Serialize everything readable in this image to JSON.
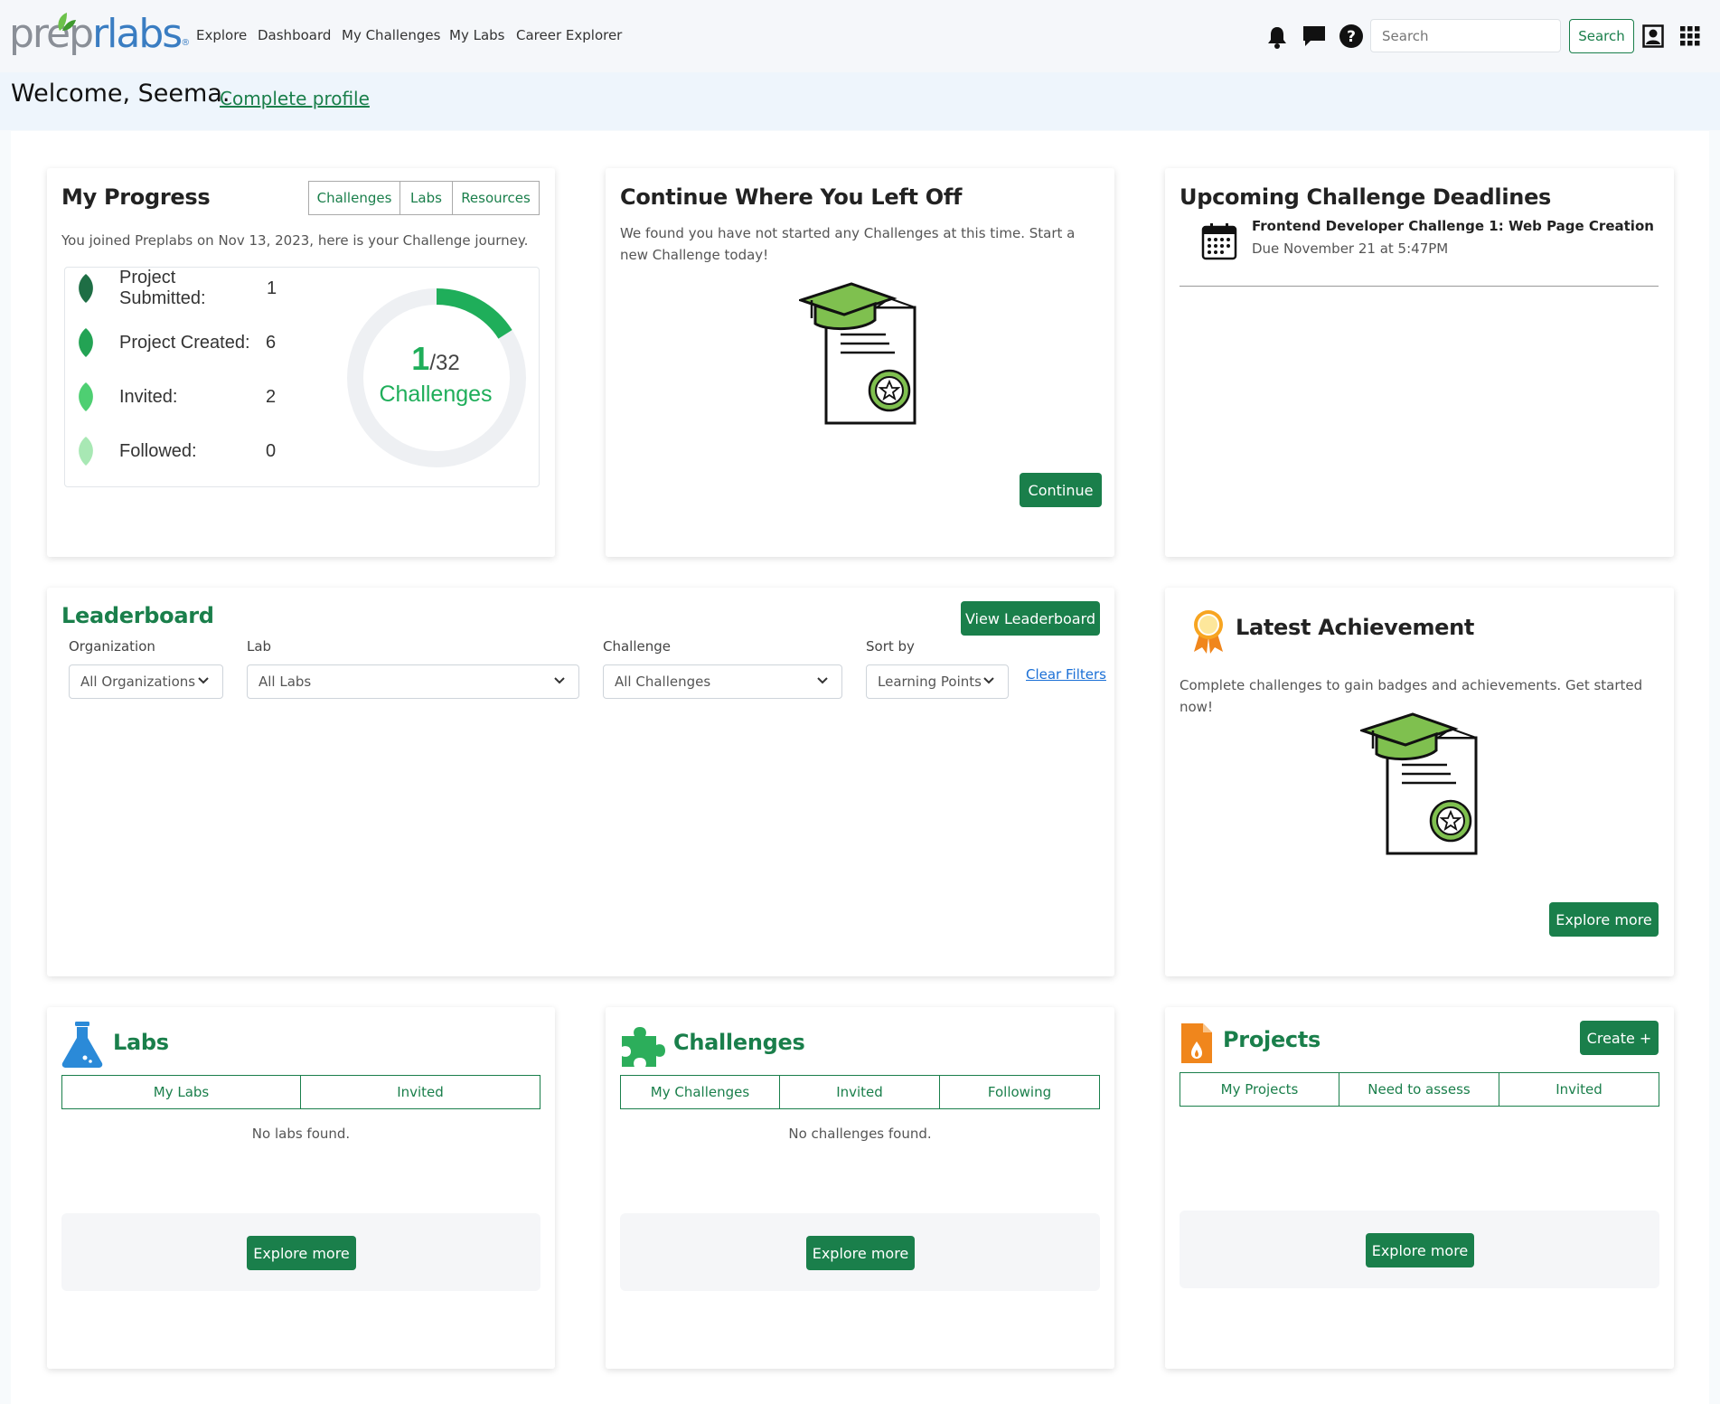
{
  "header": {
    "logo_part1": "prep",
    "logo_part2": "rlabs",
    "logo_reg": "®",
    "nav": [
      "Explore",
      "Dashboard",
      "My Challenges",
      "My Labs",
      "Career Explorer"
    ],
    "search_placeholder": "Search",
    "search_button": "Search",
    "icons": [
      "bell-icon",
      "chat-icon",
      "help-icon",
      "profile-icon",
      "apps-grid-icon"
    ]
  },
  "welcome": {
    "text": "Welcome, Seema.",
    "link": "Complete profile"
  },
  "my_progress": {
    "title": "My Progress",
    "tabs": [
      "Challenges",
      "Labs",
      "Resources"
    ],
    "subtitle": "You joined Preplabs on Nov 13, 2023, here is your Challenge journey.",
    "stats": [
      {
        "label": "Project Submitted:",
        "value": "1"
      },
      {
        "label": "Project Created:",
        "value": "6"
      },
      {
        "label": "Invited:",
        "value": "2"
      },
      {
        "label": "Followed:",
        "value": "0"
      }
    ],
    "ring_completed": "1",
    "ring_total": "/32",
    "ring_caption": "Challenges",
    "ring_fraction": 0.16
  },
  "continue_card": {
    "title": "Continue Where You Left Off",
    "text": "We found you have not started any Challenges at this time. Start a new Challenge today!",
    "button": "Continue"
  },
  "deadlines": {
    "title": "Upcoming Challenge Deadlines",
    "items": [
      {
        "name": "Frontend Developer Challenge 1: Web Page Creation",
        "due": "Due November 21 at 5:47PM"
      }
    ]
  },
  "leaderboard": {
    "title": "Leaderboard",
    "button": "View Leaderboard",
    "filters": [
      {
        "label": "Organization",
        "value": "All Organizations"
      },
      {
        "label": "Lab",
        "value": "All Labs"
      },
      {
        "label": "Challenge",
        "value": "All Challenges"
      },
      {
        "label": "Sort by",
        "value": "Learning Points"
      }
    ],
    "clear": "Clear Filters"
  },
  "achievement": {
    "title": "Latest Achievement",
    "text": "Complete challenges to gain badges and achievements. Get started now!",
    "button": "Explore more"
  },
  "labs": {
    "title": "Labs",
    "tabs": [
      "My Labs",
      "Invited"
    ],
    "empty": "No labs found.",
    "button": "Explore more"
  },
  "challenges": {
    "title": "Challenges",
    "tabs": [
      "My Challenges",
      "Invited",
      "Following"
    ],
    "empty": "No challenges found.",
    "button": "Explore more"
  },
  "projects": {
    "title": "Projects",
    "create": "Create +",
    "tabs": [
      "My Projects",
      "Need to assess",
      "Invited"
    ],
    "button": "Explore more"
  },
  "colors": {
    "brand_green": "#1a7f4b",
    "ring_green": "#1fae5a",
    "labs_blue": "#2b8ad8",
    "projects_orange": "#f0861c"
  }
}
